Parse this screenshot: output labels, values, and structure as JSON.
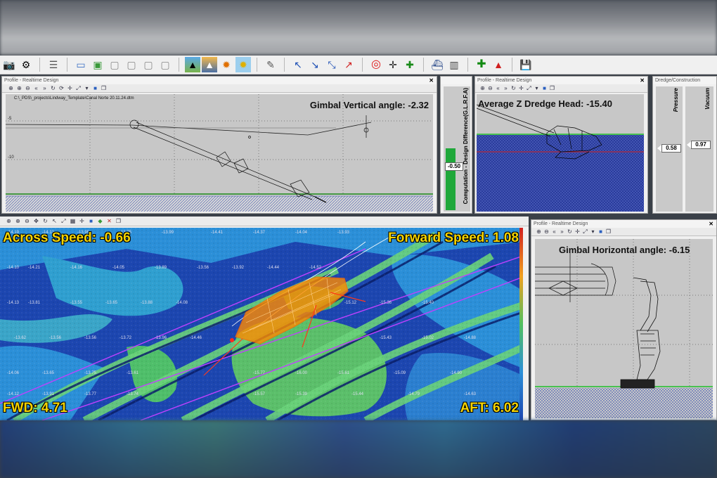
{
  "colors": {
    "accent_yellow": "#f5d400",
    "bathy_deep": "#1a3fa6",
    "bathy_mid": "#2b8fd8",
    "bathy_shallow": "#4fbf6a",
    "dredge_head": "#ff8a00",
    "canvas_gray": "#c7c7c7",
    "seabed_green": "#2fbf3a"
  },
  "toolbar": {
    "icons": [
      "camera-icon",
      "film-reel-icon",
      "settings-sliders-icon",
      "window-icon",
      "window-add-icon",
      "window-gray-icon",
      "window-gray-icon",
      "window-gray-icon",
      "window-gray-icon",
      "landscape-icon",
      "sunset-icon",
      "sun-icon",
      "sun-sky-icon",
      "pen-icon",
      "cursor-blue-icon",
      "cursor-blue2-icon",
      "cursor-blue3-icon",
      "cursor-red-icon",
      "lifebuoy-icon",
      "crosshair-add-icon",
      "crosshair-green-icon",
      "vessel-icon",
      "building-icon",
      "add-green-icon",
      "shapes-icon",
      "save-icon"
    ]
  },
  "profile_top": {
    "title": "Profile - Realtime Design",
    "file_path": "C:\\_PDS\\_projects\\Lindway_Template\\Canal Norte 20.11.24.dtm",
    "overlay": "Gimbal Vertical angle: -2.32",
    "y_ticks": [
      "-5",
      "-10"
    ]
  },
  "computation_gauge": {
    "label": "Computation - Design Difference(G.L.R.F.A)",
    "value": "-0.50"
  },
  "profile_mid": {
    "title": "Profile - Realtime Design",
    "overlay": "Average Z Dredge Head: -15.40"
  },
  "dredge_panel": {
    "title": "Dredge/Construction",
    "pressure_label": "Pressure",
    "pressure_value": "0.58",
    "vacuum_label": "Vacuum",
    "vacuum_value": "0.97"
  },
  "plan_view": {
    "across_speed": "Across Speed: -0.66",
    "forward_speed": "Forward Speed: 1.08",
    "fwd": "FWD: 4.71",
    "aft": "AFT: 6.02"
  },
  "profile_right": {
    "title": "Profile - Realtime Design",
    "overlay": "Gimbal Horizontal angle: -6.15"
  }
}
